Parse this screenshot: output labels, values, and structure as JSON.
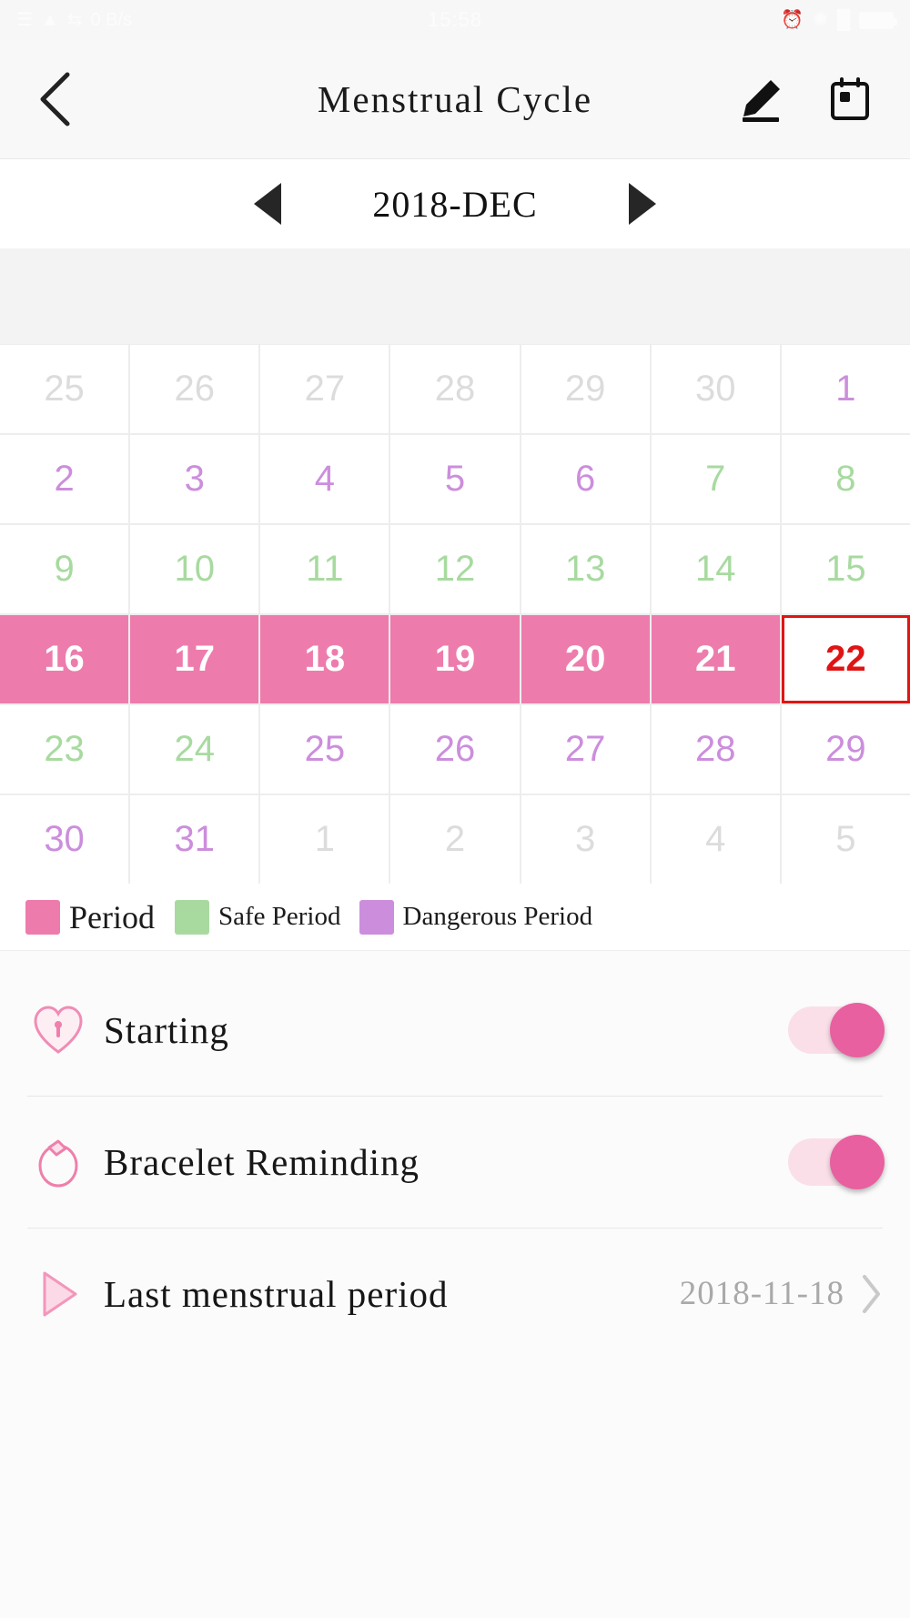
{
  "status_bar": {
    "time": "15:58",
    "left_icons": [
      "signal-icon",
      "wifi-icon",
      "sync-icon",
      "data-rate-icon"
    ],
    "right_icons": [
      "alarm-icon",
      "bluetooth-icon",
      "signal-bars-icon",
      "battery-icon"
    ],
    "data_rate": "0 B/s"
  },
  "header": {
    "back_icon": "chevron-left-icon",
    "title": "Menstrual Cycle",
    "edit_icon": "pencil-edit-icon",
    "calendar_icon": "calendar-icon"
  },
  "month_nav": {
    "prev_icon": "triangle-left-icon",
    "label": "2018-DEC",
    "next_icon": "triangle-right-icon"
  },
  "calendar": {
    "weekdays": [
      "",
      "",
      "",
      "",
      "",
      "",
      ""
    ],
    "days": [
      {
        "n": "25",
        "type": "other"
      },
      {
        "n": "26",
        "type": "other"
      },
      {
        "n": "27",
        "type": "other"
      },
      {
        "n": "28",
        "type": "other"
      },
      {
        "n": "29",
        "type": "other"
      },
      {
        "n": "30",
        "type": "other"
      },
      {
        "n": "1",
        "type": "danger"
      },
      {
        "n": "2",
        "type": "danger"
      },
      {
        "n": "3",
        "type": "danger"
      },
      {
        "n": "4",
        "type": "danger"
      },
      {
        "n": "5",
        "type": "danger"
      },
      {
        "n": "6",
        "type": "danger"
      },
      {
        "n": "7",
        "type": "safe"
      },
      {
        "n": "8",
        "type": "safe"
      },
      {
        "n": "9",
        "type": "safe"
      },
      {
        "n": "10",
        "type": "safe"
      },
      {
        "n": "11",
        "type": "safe"
      },
      {
        "n": "12",
        "type": "safe"
      },
      {
        "n": "13",
        "type": "safe"
      },
      {
        "n": "14",
        "type": "safe"
      },
      {
        "n": "15",
        "type": "safe"
      },
      {
        "n": "16",
        "type": "period"
      },
      {
        "n": "17",
        "type": "period"
      },
      {
        "n": "18",
        "type": "period"
      },
      {
        "n": "19",
        "type": "period"
      },
      {
        "n": "20",
        "type": "period"
      },
      {
        "n": "21",
        "type": "period"
      },
      {
        "n": "22",
        "type": "today"
      },
      {
        "n": "23",
        "type": "safe"
      },
      {
        "n": "24",
        "type": "safe"
      },
      {
        "n": "25",
        "type": "danger"
      },
      {
        "n": "26",
        "type": "danger"
      },
      {
        "n": "27",
        "type": "danger"
      },
      {
        "n": "28",
        "type": "danger"
      },
      {
        "n": "29",
        "type": "danger"
      },
      {
        "n": "30",
        "type": "danger"
      },
      {
        "n": "31",
        "type": "danger"
      },
      {
        "n": "1",
        "type": "other"
      },
      {
        "n": "2",
        "type": "other"
      },
      {
        "n": "3",
        "type": "other"
      },
      {
        "n": "4",
        "type": "other"
      },
      {
        "n": "5",
        "type": "other"
      }
    ]
  },
  "legend": [
    {
      "label": "Period",
      "color": "#ed7cad"
    },
    {
      "label": "Safe Period",
      "color": "#a8daa0"
    },
    {
      "label": "Dangerous Period",
      "color": "#cc8edc"
    }
  ],
  "settings": [
    {
      "icon": "heart-lock-icon",
      "label": "Starting",
      "control": "toggle",
      "value": "on"
    },
    {
      "icon": "bracelet-icon",
      "label": "Bracelet Reminding",
      "control": "toggle",
      "value": "on"
    },
    {
      "icon": "play-triangle-icon",
      "label": "Last menstrual period",
      "control": "value",
      "value": "2018-11-18",
      "chevron": "chevron-right-icon"
    }
  ],
  "colors": {
    "period": "#ed7cad",
    "safe": "#a8daa0",
    "danger": "#cc8edc",
    "today_outline": "#e11414",
    "accent": "#e8609f"
  }
}
